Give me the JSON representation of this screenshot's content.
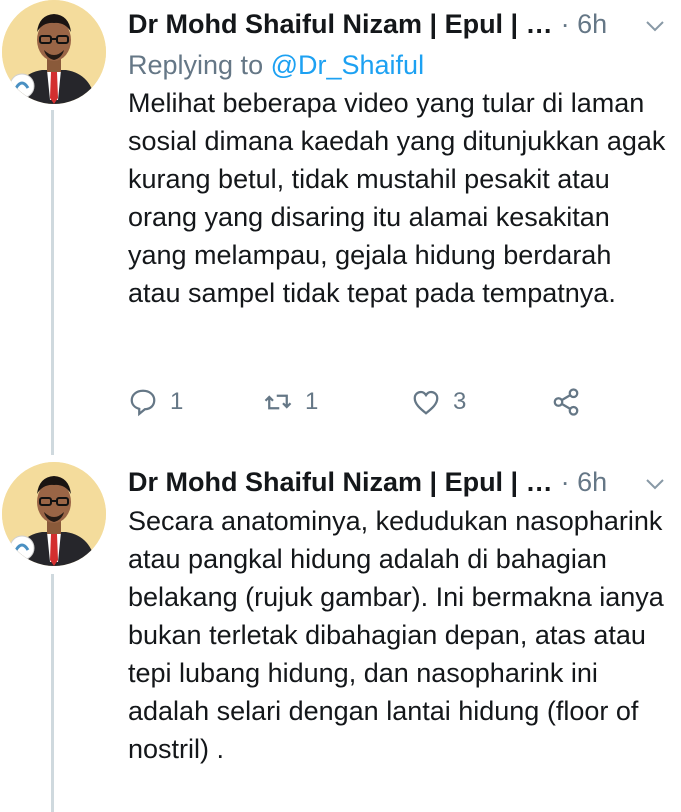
{
  "tweets": [
    {
      "author": "Dr Mohd Shaiful Nizam | Epul | …",
      "time": "· 6h",
      "replying_prefix": "Replying to ",
      "replying_handle": "@Dr_Shaiful",
      "text": "Melihat beberapa video yang tular di laman sosial dimana kaedah yang ditunjukkan agak kurang betul, tidak mustahil pesakit atau orang yang disaring itu alamai kesakitan yang melampau, gejala hidung berdarah atau sampel tidak tepat pada tempatnya.",
      "replies": "1",
      "retweets": "1",
      "likes": "3"
    },
    {
      "author": "Dr Mohd Shaiful Nizam | Epul | …",
      "time": "· 6h",
      "text": "Secara anatominya, kedudukan nasopharink atau pangkal hidung adalah di bahagian belakang (rujuk gambar).  Ini bermakna ianya bukan terletak dibahagian depan, atas atau tepi lubang hidung, dan nasopharink  ini adalah selari dengan lantai hidung (floor of nostril) ."
    }
  ],
  "colors": {
    "link": "#1da1f2",
    "muted": "#657786",
    "line": "#cfd9de"
  }
}
